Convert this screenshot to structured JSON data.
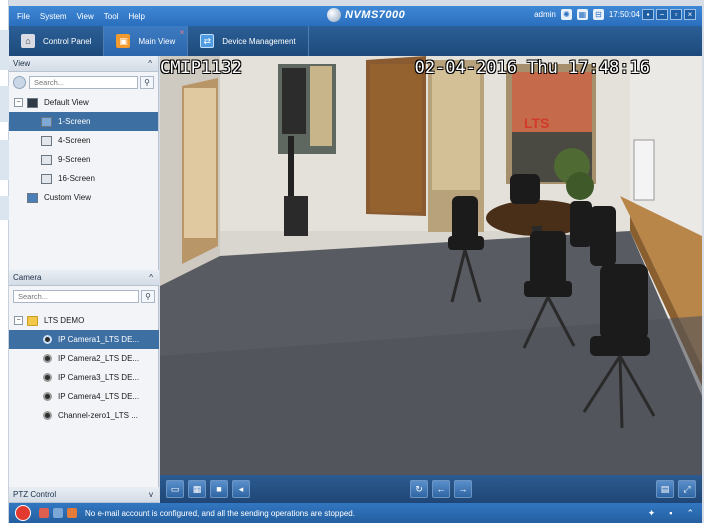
{
  "menu": [
    "File",
    "System",
    "View",
    "Tool",
    "Help"
  ],
  "app_name": "NVMS7000",
  "user": "admin",
  "clock": "17:50:04",
  "window_controls": [
    "−",
    "▫",
    "×"
  ],
  "tabs": [
    {
      "label": "Control Panel",
      "icon": "control-panel-icon"
    },
    {
      "label": "Main View",
      "icon": "main-view-icon",
      "active": true
    },
    {
      "label": "Device Management",
      "icon": "device-management-icon"
    }
  ],
  "view_panel": {
    "title": "View",
    "collapse": "^",
    "search_placeholder": "Search...",
    "items": [
      {
        "label": "Default View",
        "level": 0
      },
      {
        "label": "1-Screen",
        "level": 1,
        "selected": true
      },
      {
        "label": "4-Screen",
        "level": 1
      },
      {
        "label": "9-Screen",
        "level": 1
      },
      {
        "label": "16-Screen",
        "level": 1
      },
      {
        "label": "Custom View",
        "level": 0
      }
    ]
  },
  "camera_panel": {
    "title": "Camera",
    "collapse": "^",
    "search_placeholder": "Search...",
    "group": "LTS DEMO",
    "cameras": [
      {
        "label": "IP Camera1_LTS DE...",
        "selected": true
      },
      {
        "label": "IP Camera2_LTS DE..."
      },
      {
        "label": "IP Camera3_LTS DE..."
      },
      {
        "label": "IP Camera4_LTS DE..."
      },
      {
        "label": "Channel-zero1_LTS ..."
      }
    ]
  },
  "ptz": {
    "title": "PTZ Control",
    "chevron": "v"
  },
  "video": {
    "camera_name": "CMIP1132",
    "timestamp": "02-04-2016 Thu 17:48:16"
  },
  "status": {
    "message": "No e-mail account is configured, and all the sending operations are stopped."
  },
  "colors": {
    "accent": "#2a6fbe",
    "tab_bar": "#1d4a7b",
    "selected_row": "#3d6fa3"
  }
}
